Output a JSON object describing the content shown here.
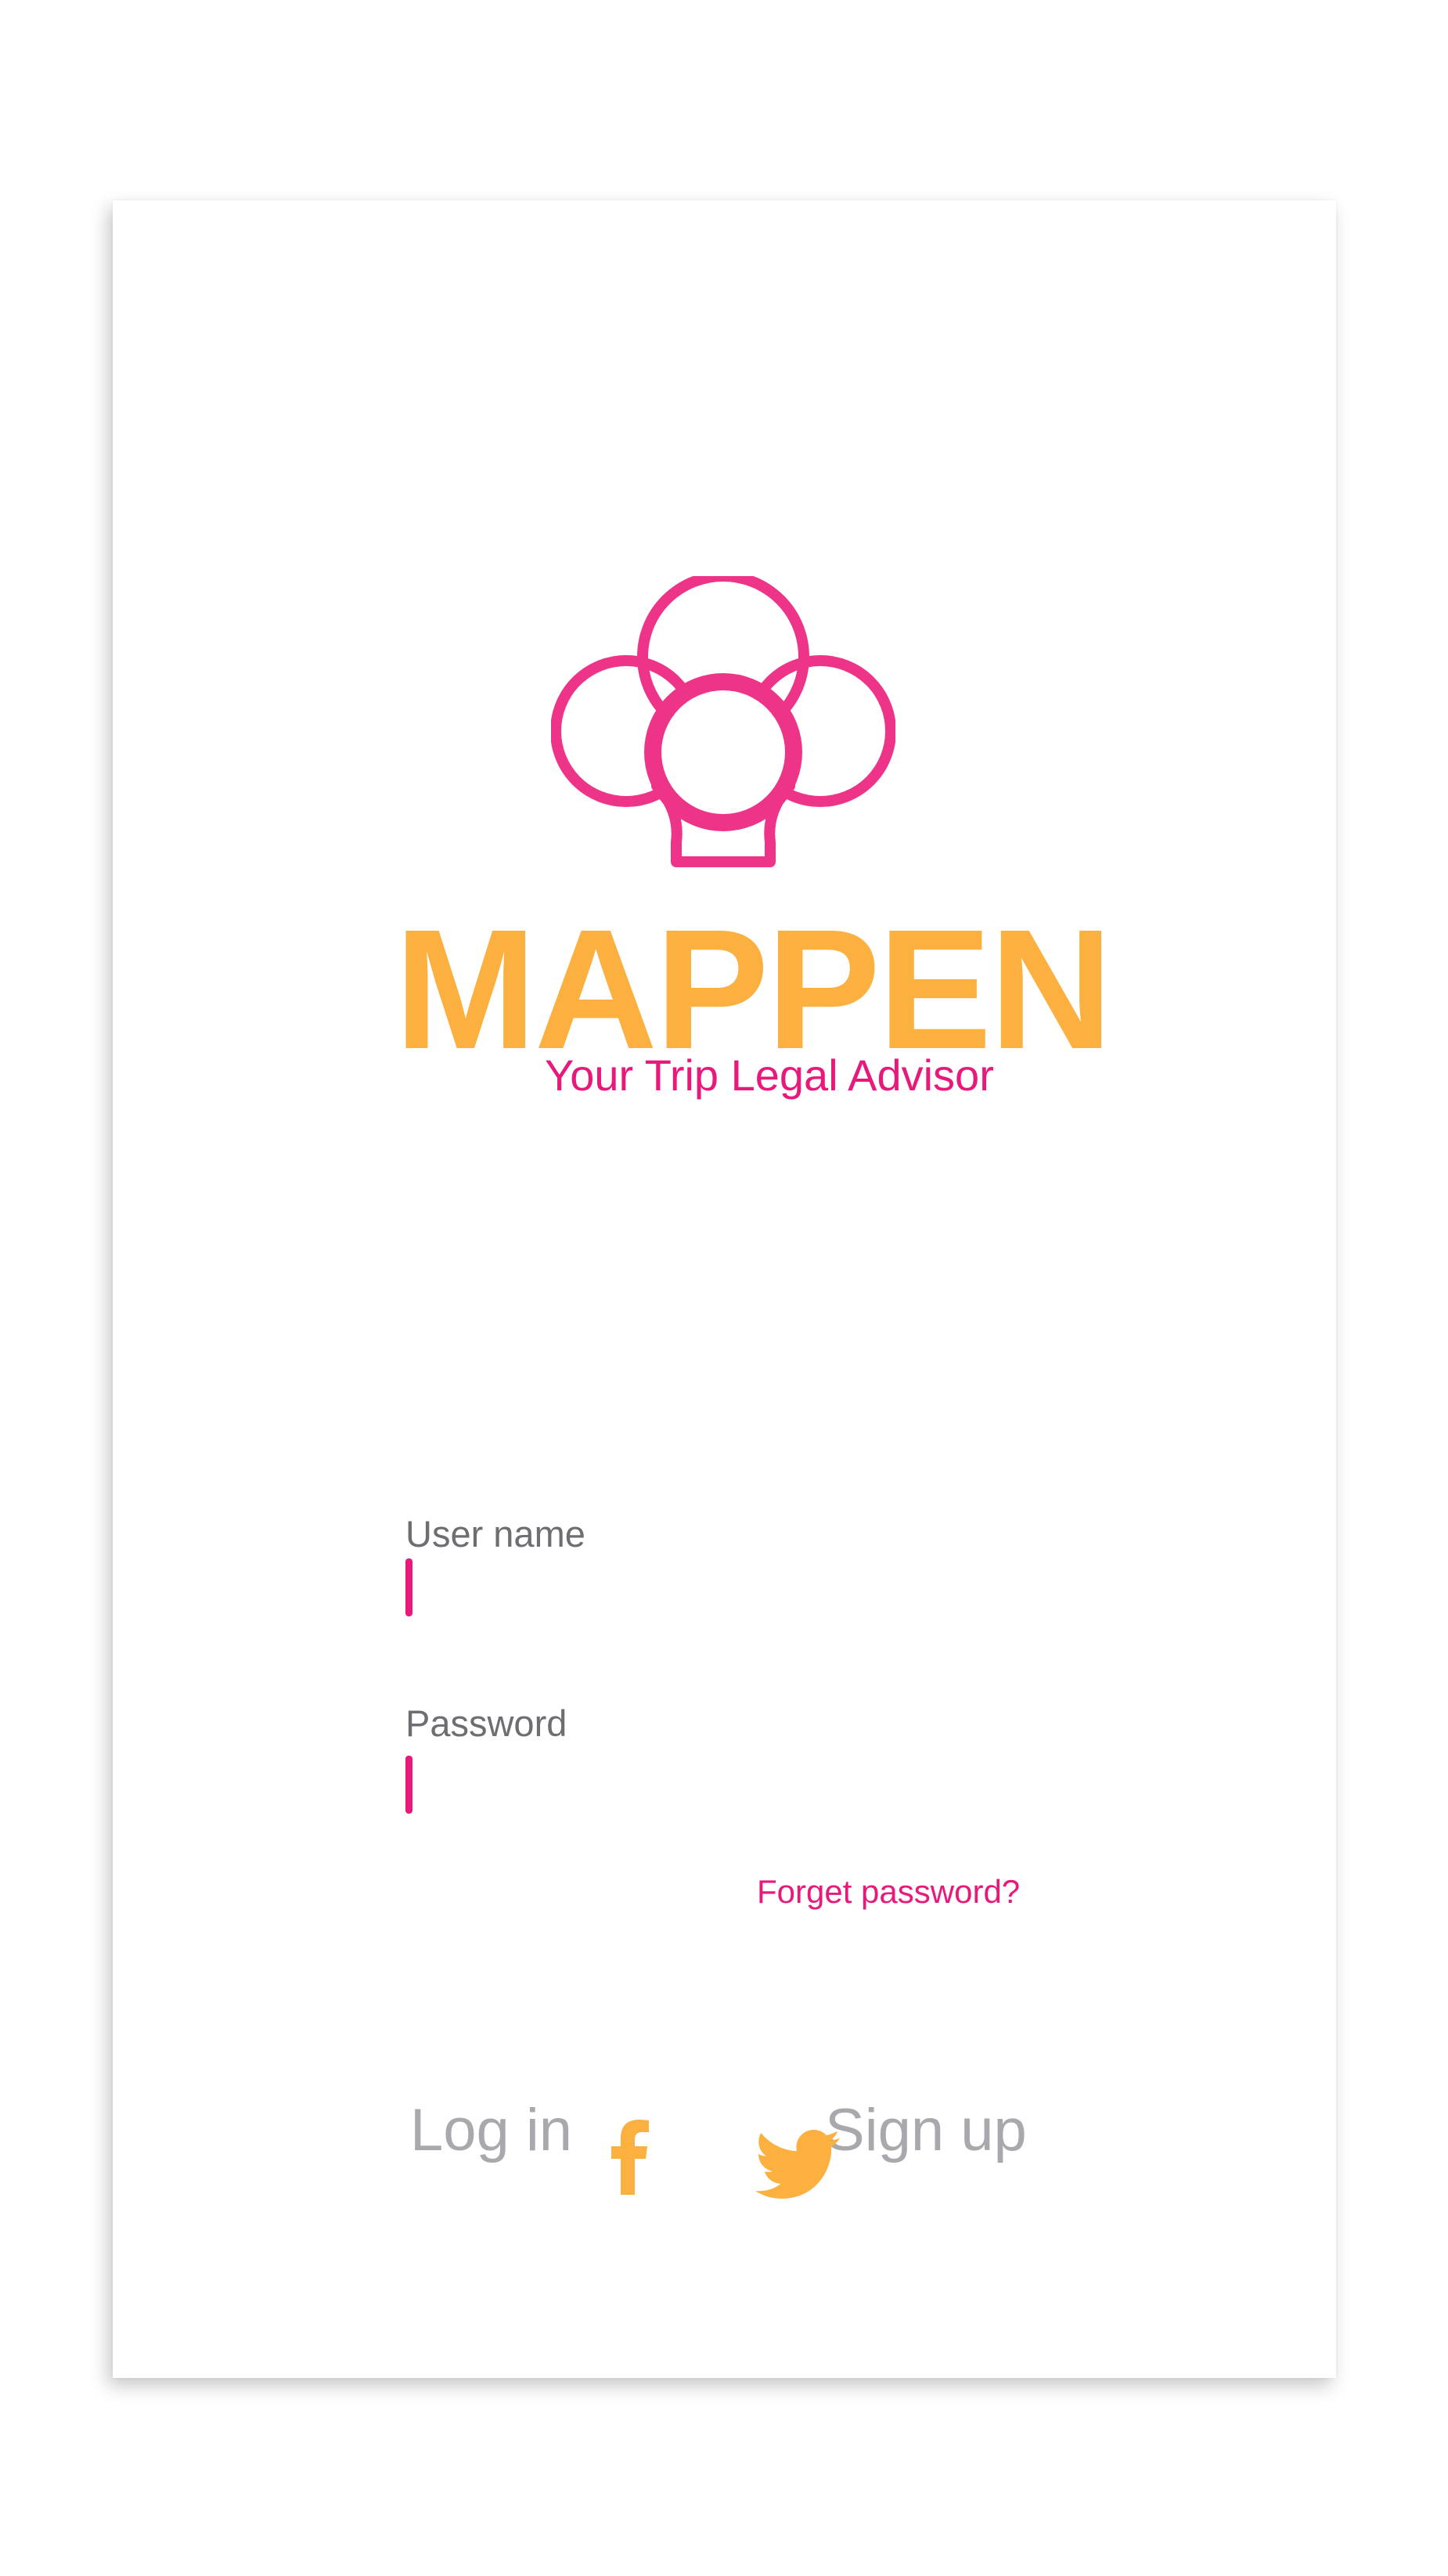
{
  "app": {
    "name": "MAPPEN",
    "tagline": "Your Trip Legal Advisor"
  },
  "login_form": {
    "username_label": "User name",
    "username_value": "",
    "password_label": "Password",
    "password_value": "",
    "forgot_password_link": "Forget password?"
  },
  "actions": {
    "login_label": "Log in",
    "signup_label": "Sign up"
  },
  "social": [
    {
      "icon": "facebook-icon"
    },
    {
      "icon": "twitter-icon"
    }
  ],
  "colors": {
    "brand_orange": "#fbb040",
    "accent_pink": "#e8197a",
    "logo_pink": "#ee3488",
    "label_gray": "#6d6e71",
    "action_gray": "#a7a9ac"
  }
}
